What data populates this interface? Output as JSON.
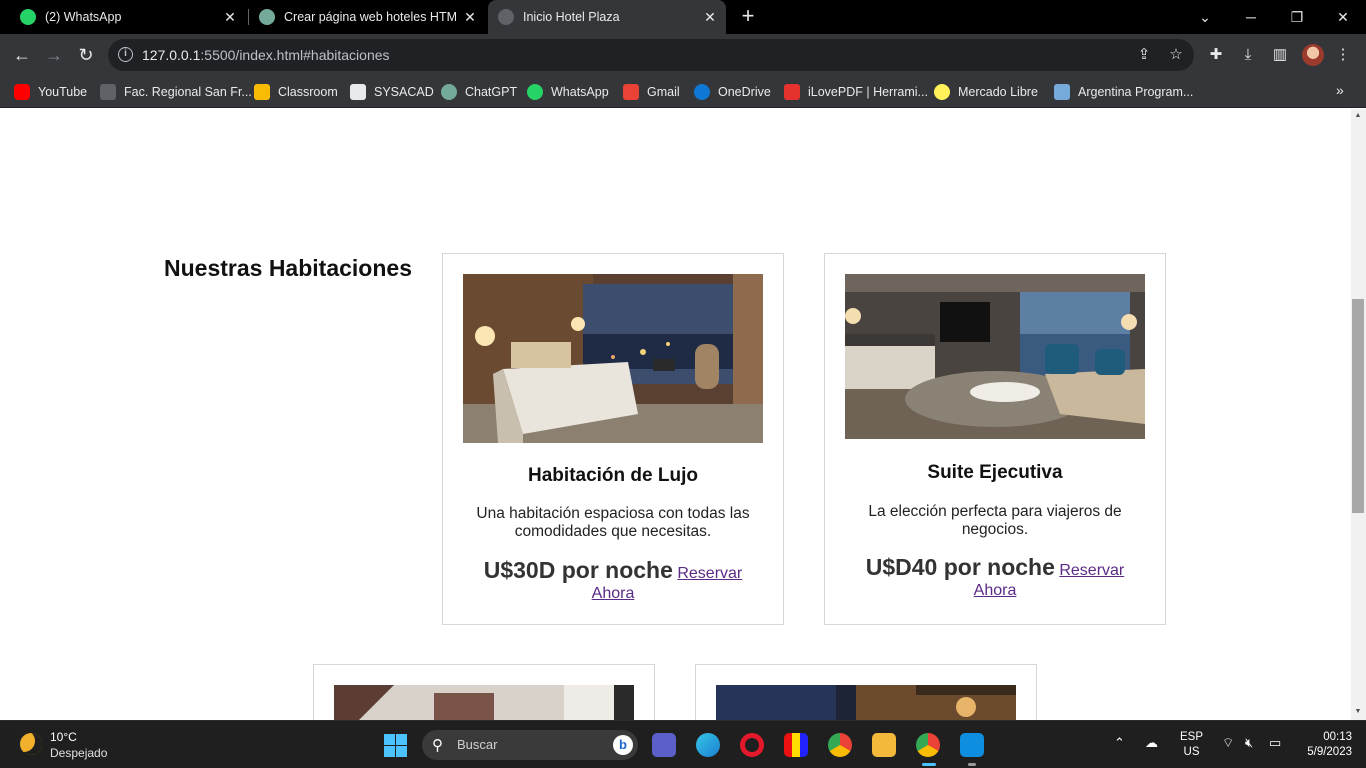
{
  "tabs": [
    {
      "title": "(2) WhatsApp",
      "icon": "whatsapp-icon",
      "color": "#25d366"
    },
    {
      "title": "Crear página web hoteles HTML/",
      "icon": "chatgpt-icon",
      "color": "#74aa9c"
    },
    {
      "title": "Inicio Hotel Plaza",
      "icon": "globe-icon",
      "color": "#9aa0a6"
    }
  ],
  "toolbar": {
    "url_host": "127.0.0.1",
    "url_rest": ":5500/index.html#habitaciones"
  },
  "bookmarks": [
    {
      "label": "YouTube",
      "icon": "youtube-icon",
      "color": "#ff0000"
    },
    {
      "label": "Fac. Regional San Fr...",
      "icon": "utn-icon",
      "color": "#9aa0a6"
    },
    {
      "label": "Classroom",
      "icon": "classroom-icon",
      "color": "#f9bb04"
    },
    {
      "label": "SYSACAD",
      "icon": "utn-icon",
      "color": "#ffffff"
    },
    {
      "label": "ChatGPT",
      "icon": "chatgpt-icon",
      "color": "#74aa9c"
    },
    {
      "label": "WhatsApp",
      "icon": "whatsapp-icon",
      "color": "#25d366"
    },
    {
      "label": "Gmail",
      "icon": "gmail-icon",
      "color": "#ea4335"
    },
    {
      "label": "OneDrive",
      "icon": "onedrive-icon",
      "color": "#0364b8"
    },
    {
      "label": "iLovePDF | Herrami...",
      "icon": "ilovepdf-icon",
      "color": "#e5322d"
    },
    {
      "label": "Mercado Libre",
      "icon": "mercadolibre-icon",
      "color": "#fff159"
    },
    {
      "label": "Argentina Program...",
      "icon": "argentina-icon",
      "color": "#75aadb"
    }
  ],
  "page": {
    "section_title": "Nuestras Habitaciones",
    "rooms": [
      {
        "title": "Habitación de Lujo",
        "description": "Una habitación espaciosa con todas las comodidades que necesitas.",
        "price": "U$30D por noche",
        "reserve_label": "Reservar Ahora"
      },
      {
        "title": "Suite Ejecutiva",
        "description": "La elección perfecta para viajeros de negocios.",
        "price": "U$D40 por noche",
        "reserve_label": "Reservar Ahora"
      }
    ]
  },
  "taskbar": {
    "temperature": "10°C",
    "weather": "Despejado",
    "search_placeholder": "Buscar",
    "language": "ESP",
    "region": "US",
    "time": "00:13",
    "date": "5/9/2023"
  }
}
